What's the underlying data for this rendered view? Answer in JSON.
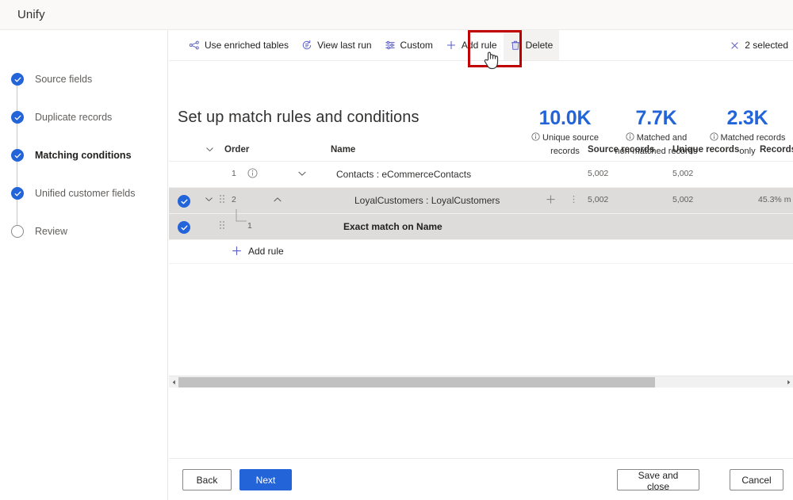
{
  "app": {
    "title": "Unify"
  },
  "sidebar": {
    "items": [
      {
        "label": "Source fields",
        "state": "done",
        "current": false
      },
      {
        "label": "Duplicate records",
        "state": "done",
        "current": false
      },
      {
        "label": "Matching conditions",
        "state": "done",
        "current": true
      },
      {
        "label": "Unified customer fields",
        "state": "done",
        "current": false
      },
      {
        "label": "Review",
        "state": "todo",
        "current": false
      }
    ]
  },
  "toolbar": {
    "commands": [
      {
        "label": "Use enriched tables",
        "icon": "share-nodes-icon"
      },
      {
        "label": "View last run",
        "icon": "history-icon"
      },
      {
        "label": "Custom",
        "icon": "settings-sliders-icon"
      },
      {
        "label": "Add rule",
        "icon": "plus-icon"
      },
      {
        "label": "Delete",
        "icon": "trash-icon"
      }
    ],
    "selection": {
      "label": "2 selected",
      "icon": "close-icon"
    }
  },
  "main": {
    "page_title": "Set up match rules and conditions",
    "kpis": [
      {
        "value": "10.0K",
        "caption_line1": "Unique source",
        "caption_line2": "records"
      },
      {
        "value": "7.7K",
        "caption_line1": "Matched and",
        "caption_line2": "non-matched records"
      },
      {
        "value": "2.3K",
        "caption_line1": "Matched records",
        "caption_line2": "only"
      }
    ],
    "grid": {
      "columns": [
        "Order",
        "Name",
        "Source records",
        "Unique records",
        "Records"
      ],
      "rows": [
        {
          "selected": false,
          "order": "1",
          "name": "Contacts : eCommerceContacts",
          "source_records": "5,002",
          "unique_records": "5,002",
          "records_pct": ""
        },
        {
          "selected": true,
          "order": "2",
          "name": "LoyalCustomers : LoyalCustomers",
          "source_records": "5,002",
          "unique_records": "5,002",
          "records_pct": "45.3% m"
        },
        {
          "selected": true,
          "order": "1",
          "name": "Exact match on Name",
          "child": true,
          "source_records": "",
          "unique_records": "",
          "records_pct": ""
        }
      ],
      "add_rule_label": "Add rule"
    }
  },
  "footer": {
    "back": "Back",
    "next": "Next",
    "save_and_close": "Save and close",
    "cancel": "Cancel"
  },
  "colors": {
    "accent": "#2464d9",
    "annotation": "#c00000",
    "row_selected": "#dedcdb"
  }
}
